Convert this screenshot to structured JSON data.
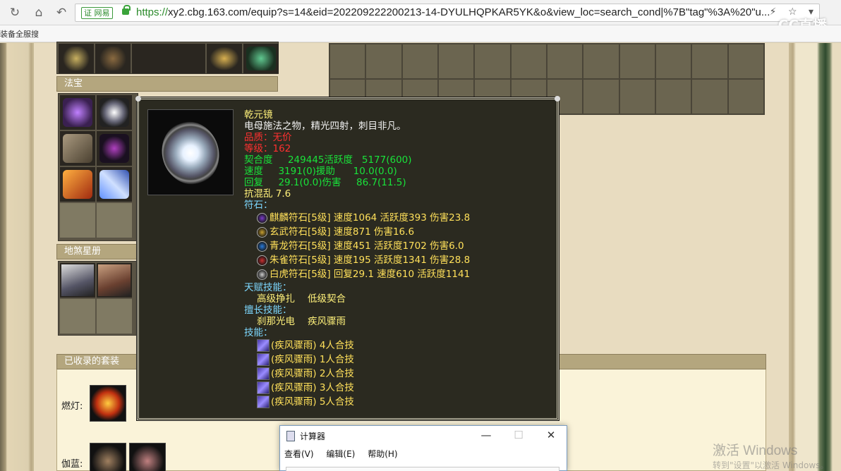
{
  "browser": {
    "cert_label": "证 网易",
    "url_scheme": "https://",
    "url_rest": "xy2.cbg.163.com/equip?s=14&eid=202209222200213-14-DYULHQPKAR5YK&o&view_loc=search_cond|%7B\"tag\"%3A%20\"u...",
    "bookmark": "装备全服搜",
    "cc_watermark": "CC直播"
  },
  "page": {
    "fabao_header": "法宝",
    "disha_header": "地煞星册",
    "suit_header": "已收录的套装",
    "suit_rows": [
      {
        "label": "燃灯:"
      },
      {
        "label": "伽蓝:"
      }
    ]
  },
  "tooltip": {
    "name": "乾元镜",
    "desc": "电母施法之物，精光四射，刺目非凡。",
    "quality": "品质：无价",
    "level": "等级：162",
    "stats": [
      "契合度     249445活跃度   5177(600)",
      "速度     3191(0)援助      10.0(0.0)",
      "回复     29.1(0.0)伤害     86.7(11.5)"
    ],
    "resist": "抗混乱 7.6",
    "runes_label": "符石：",
    "runes": [
      {
        "text": "麒麟符石[5级] 速度1064 活跃度393 伤害23.8",
        "color": "#7a3cc8"
      },
      {
        "text": "玄武符石[5级] 速度871 伤害16.6",
        "color": "#c8a030"
      },
      {
        "text": "青龙符石[5级] 速度451 活跃度1702 伤害6.0",
        "color": "#2a7ad8"
      },
      {
        "text": "朱雀符石[5级] 速度195 活跃度1341 伤害28.8",
        "color": "#c83030"
      },
      {
        "text": "白虎符石[5级] 回复29.1 速度610 活跃度1141",
        "color": "#cccccc"
      }
    ],
    "talent_label": "天赋技能：",
    "talent_skills": [
      "高级挣扎",
      "低级契合"
    ],
    "expertise_label": "擅长技能：",
    "expertise_skills": [
      "刹那光电",
      "疾风骤雨"
    ],
    "skills_label": "技能：",
    "skills": [
      "(疾风骤雨) 4人合技",
      "(疾风骤雨) 1人合技",
      "(疾风骤雨) 2人合技",
      "(疾风骤雨) 3人合技",
      "(疾风骤雨) 5人合技"
    ]
  },
  "calculator": {
    "title": "计算器",
    "menu": [
      "查看(V)",
      "编辑(E)",
      "帮助(H)"
    ]
  },
  "windows_watermark": {
    "title": "激活 Windows",
    "sub": "转到\"设置\"以激活 Windows。"
  }
}
